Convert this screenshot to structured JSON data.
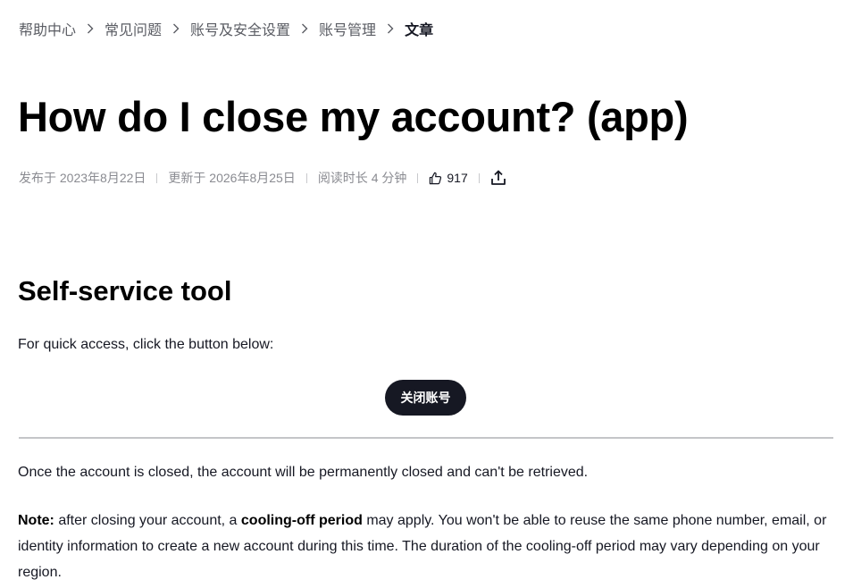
{
  "breadcrumb": {
    "items": [
      "帮助中心",
      "常见问题",
      "账号及安全设置",
      "账号管理"
    ],
    "current": "文章",
    "separator_icon": "chevron-right-icon"
  },
  "article": {
    "title": "How do I close my account? (app)",
    "meta": {
      "published": "发布于 2023年8月22日",
      "updated": "更新于 2026年8月25日",
      "read_time": "阅读时长 4 分钟",
      "likes": "917",
      "like_icon": "thumbs-up-icon",
      "share_icon": "share-icon"
    },
    "section_title": "Self-service tool",
    "intro": "For quick access, click the button below:",
    "close_button_label": "关闭账号",
    "paragraph1": "Once the account is closed, the account will be permanently closed and can't be retrieved.",
    "note": {
      "label": "Note:",
      "text_before": " after closing your account, a ",
      "bold_term": "cooling-off period",
      "text_after": " may apply. You won't be able to reuse the same phone number, email, or identity information to create a new account during this time. The duration of the cooling-off period may vary depending on your region."
    }
  },
  "colors": {
    "text_primary": "#161823",
    "text_secondary": "#8a8b91",
    "button_bg": "#161823",
    "divider": "#c4c5c8"
  }
}
